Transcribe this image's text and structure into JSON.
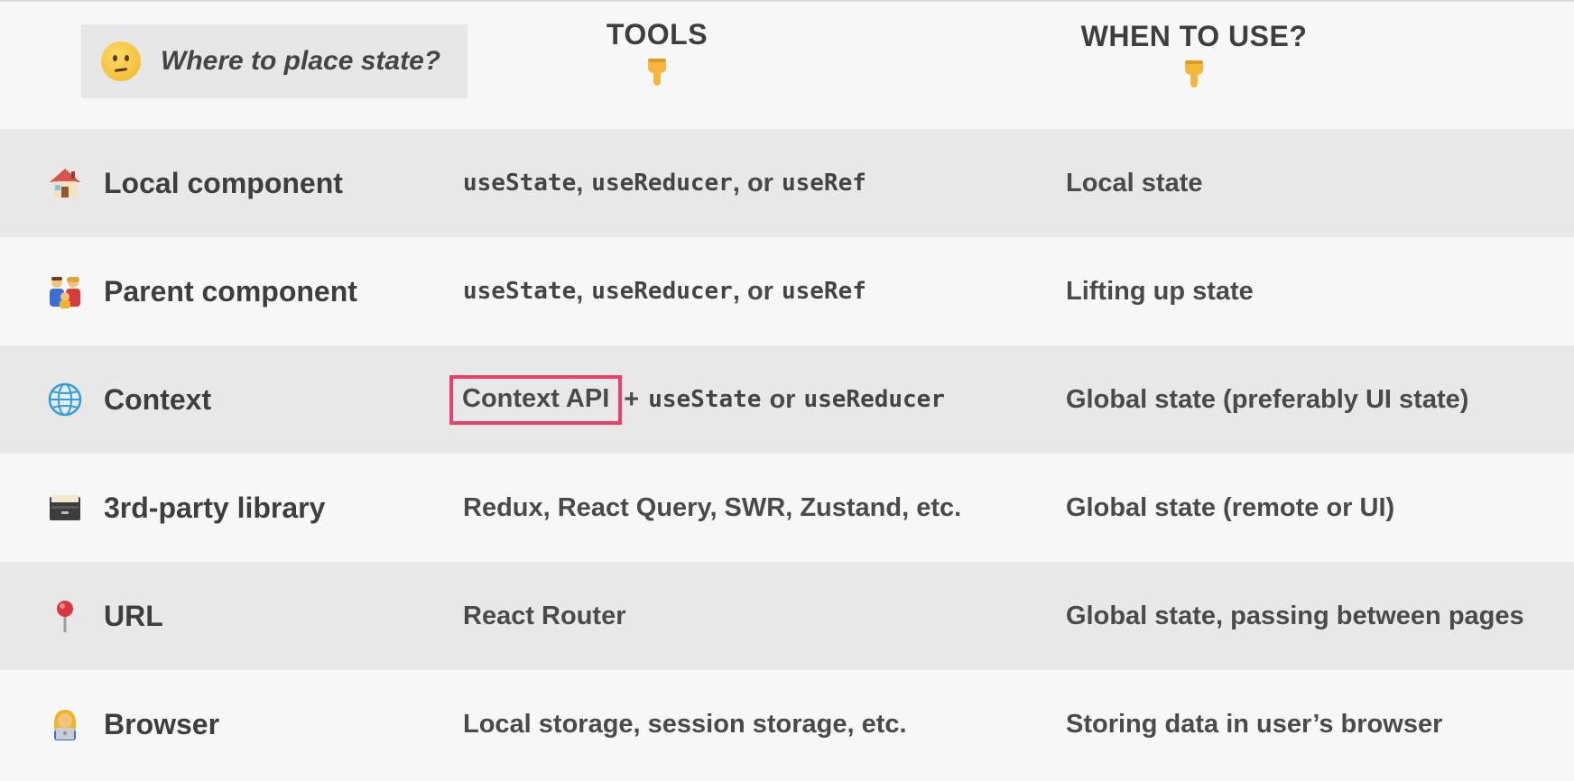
{
  "header": {
    "title": "Where to place state?",
    "title_icon": "thinking-face-icon",
    "tools_label": "TOOLS",
    "when_label": "WHEN TO USE?",
    "pointer_icon": "pointing-down-hand-icon"
  },
  "colors": {
    "background": "#f7f7f7",
    "row_shade": "#e8e8e8",
    "highlight_border": "#e8426a",
    "text": "#444444"
  },
  "rows": [
    {
      "icon": "house-icon",
      "name": "Local component",
      "tools": {
        "code1": "useState",
        "sep1": ",",
        "code2": "useReducer",
        "sep2": ", or",
        "code3": "useRef"
      },
      "when": "Local state"
    },
    {
      "icon": "family-icon",
      "name": "Parent component",
      "tools": {
        "code1": "useState",
        "sep1": ",",
        "code2": "useReducer",
        "sep2": ", or",
        "code3": "useRef"
      },
      "when": "Lifting up state"
    },
    {
      "icon": "globe-icon",
      "name": "Context",
      "tools": {
        "highlighted": "Context API",
        "plus": "+",
        "code1": "useState",
        "sep1": "or",
        "code2": "useReducer"
      },
      "when": "Global state (preferably UI state)"
    },
    {
      "icon": "file-cabinet-icon",
      "name": "3rd-party library",
      "tools": {
        "text": "Redux, React Query, SWR, Zustand, etc."
      },
      "when": "Global state (remote or UI)"
    },
    {
      "icon": "round-pushpin-icon",
      "name": "URL",
      "tools": {
        "text": "React Router"
      },
      "when": "Global state, passing between pages"
    },
    {
      "icon": "technologist-icon",
      "name": "Browser",
      "tools": {
        "text": "Local storage, session storage, etc."
      },
      "when": "Storing data in user’s browser"
    }
  ]
}
